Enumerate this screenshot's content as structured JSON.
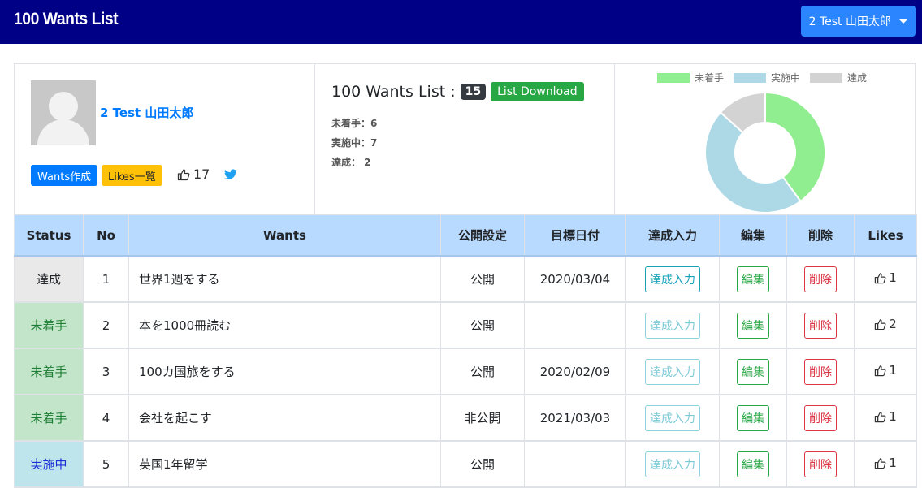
{
  "navbar": {
    "brand": "100 Wants List",
    "user_button": "2 Test 山田太郎"
  },
  "profile": {
    "username": "2 Test 山田太郎",
    "wants_button": "Wants作成",
    "likes_button": "Likes一覧",
    "like_count": "17"
  },
  "summary": {
    "title": "100 Wants List :",
    "count": "15",
    "download_button": "List Download",
    "stats": [
      "未着手：6",
      "実施中：7",
      "達成： 2"
    ]
  },
  "chart_data": {
    "type": "pie",
    "categories": [
      "未着手",
      "実施中",
      "達成"
    ],
    "values": [
      6,
      7,
      2
    ],
    "colors": [
      "#90ee90",
      "#add8e6",
      "#d3d3d3"
    ],
    "legend": "top"
  },
  "table": {
    "headers": [
      "Status",
      "No",
      "Wants",
      "公開設定",
      "目標日付",
      "達成入力",
      "編集",
      "削除",
      "Likes"
    ],
    "rows": [
      {
        "status": "達成",
        "status_class": "st-done",
        "no": "1",
        "want": "世界1週をする",
        "pub": "公開",
        "date": "2020/03/04",
        "achieve": "達成入力",
        "achieve_dim": false,
        "edit": "編集",
        "del": "削除",
        "likes": "1"
      },
      {
        "status": "未着手",
        "status_class": "st-todo",
        "no": "2",
        "want": "本を1000冊読む",
        "pub": "公開",
        "date": "",
        "achieve": "達成入力",
        "achieve_dim": true,
        "edit": "編集",
        "del": "削除",
        "likes": "2"
      },
      {
        "status": "未着手",
        "status_class": "st-todo",
        "no": "3",
        "want": "100カ国旅をする",
        "pub": "公開",
        "date": "2020/02/09",
        "achieve": "達成入力",
        "achieve_dim": true,
        "edit": "編集",
        "del": "削除",
        "likes": "1"
      },
      {
        "status": "未着手",
        "status_class": "st-todo",
        "no": "4",
        "want": "会社を起こす",
        "pub": "非公開",
        "date": "2021/03/03",
        "achieve": "達成入力",
        "achieve_dim": true,
        "edit": "編集",
        "del": "削除",
        "likes": "1"
      },
      {
        "status": "実施中",
        "status_class": "st-doing",
        "no": "5",
        "want": "英国1年留学",
        "pub": "公開",
        "date": "",
        "achieve": "達成入力",
        "achieve_dim": true,
        "edit": "編集",
        "del": "削除",
        "likes": "1"
      }
    ]
  }
}
